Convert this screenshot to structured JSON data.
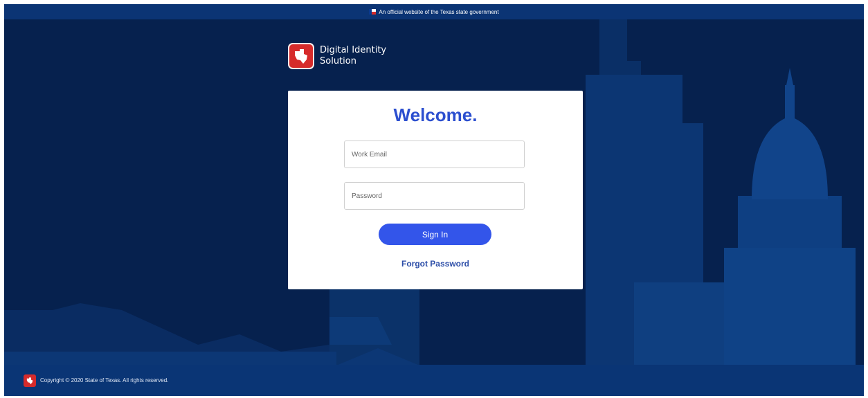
{
  "topbar": {
    "official_text": "An official website of the Texas state government"
  },
  "brand": {
    "line1": "Digital Identity",
    "line2": "Solution",
    "icon": "texas-star-icon"
  },
  "card": {
    "title": "Welcome.",
    "email_placeholder": "Work Email",
    "password_placeholder": "Password",
    "signin_label": "Sign In",
    "forgot_label": "Forgot Password"
  },
  "footer": {
    "copyright": "Copyright © 2020 State of Texas. All rights reserved."
  },
  "colors": {
    "page_background": "#06214e",
    "topbar": "#0b3474",
    "accent_blue": "#3355ea",
    "title_blue": "#2c4fcf",
    "brand_red": "#d62b2b"
  }
}
